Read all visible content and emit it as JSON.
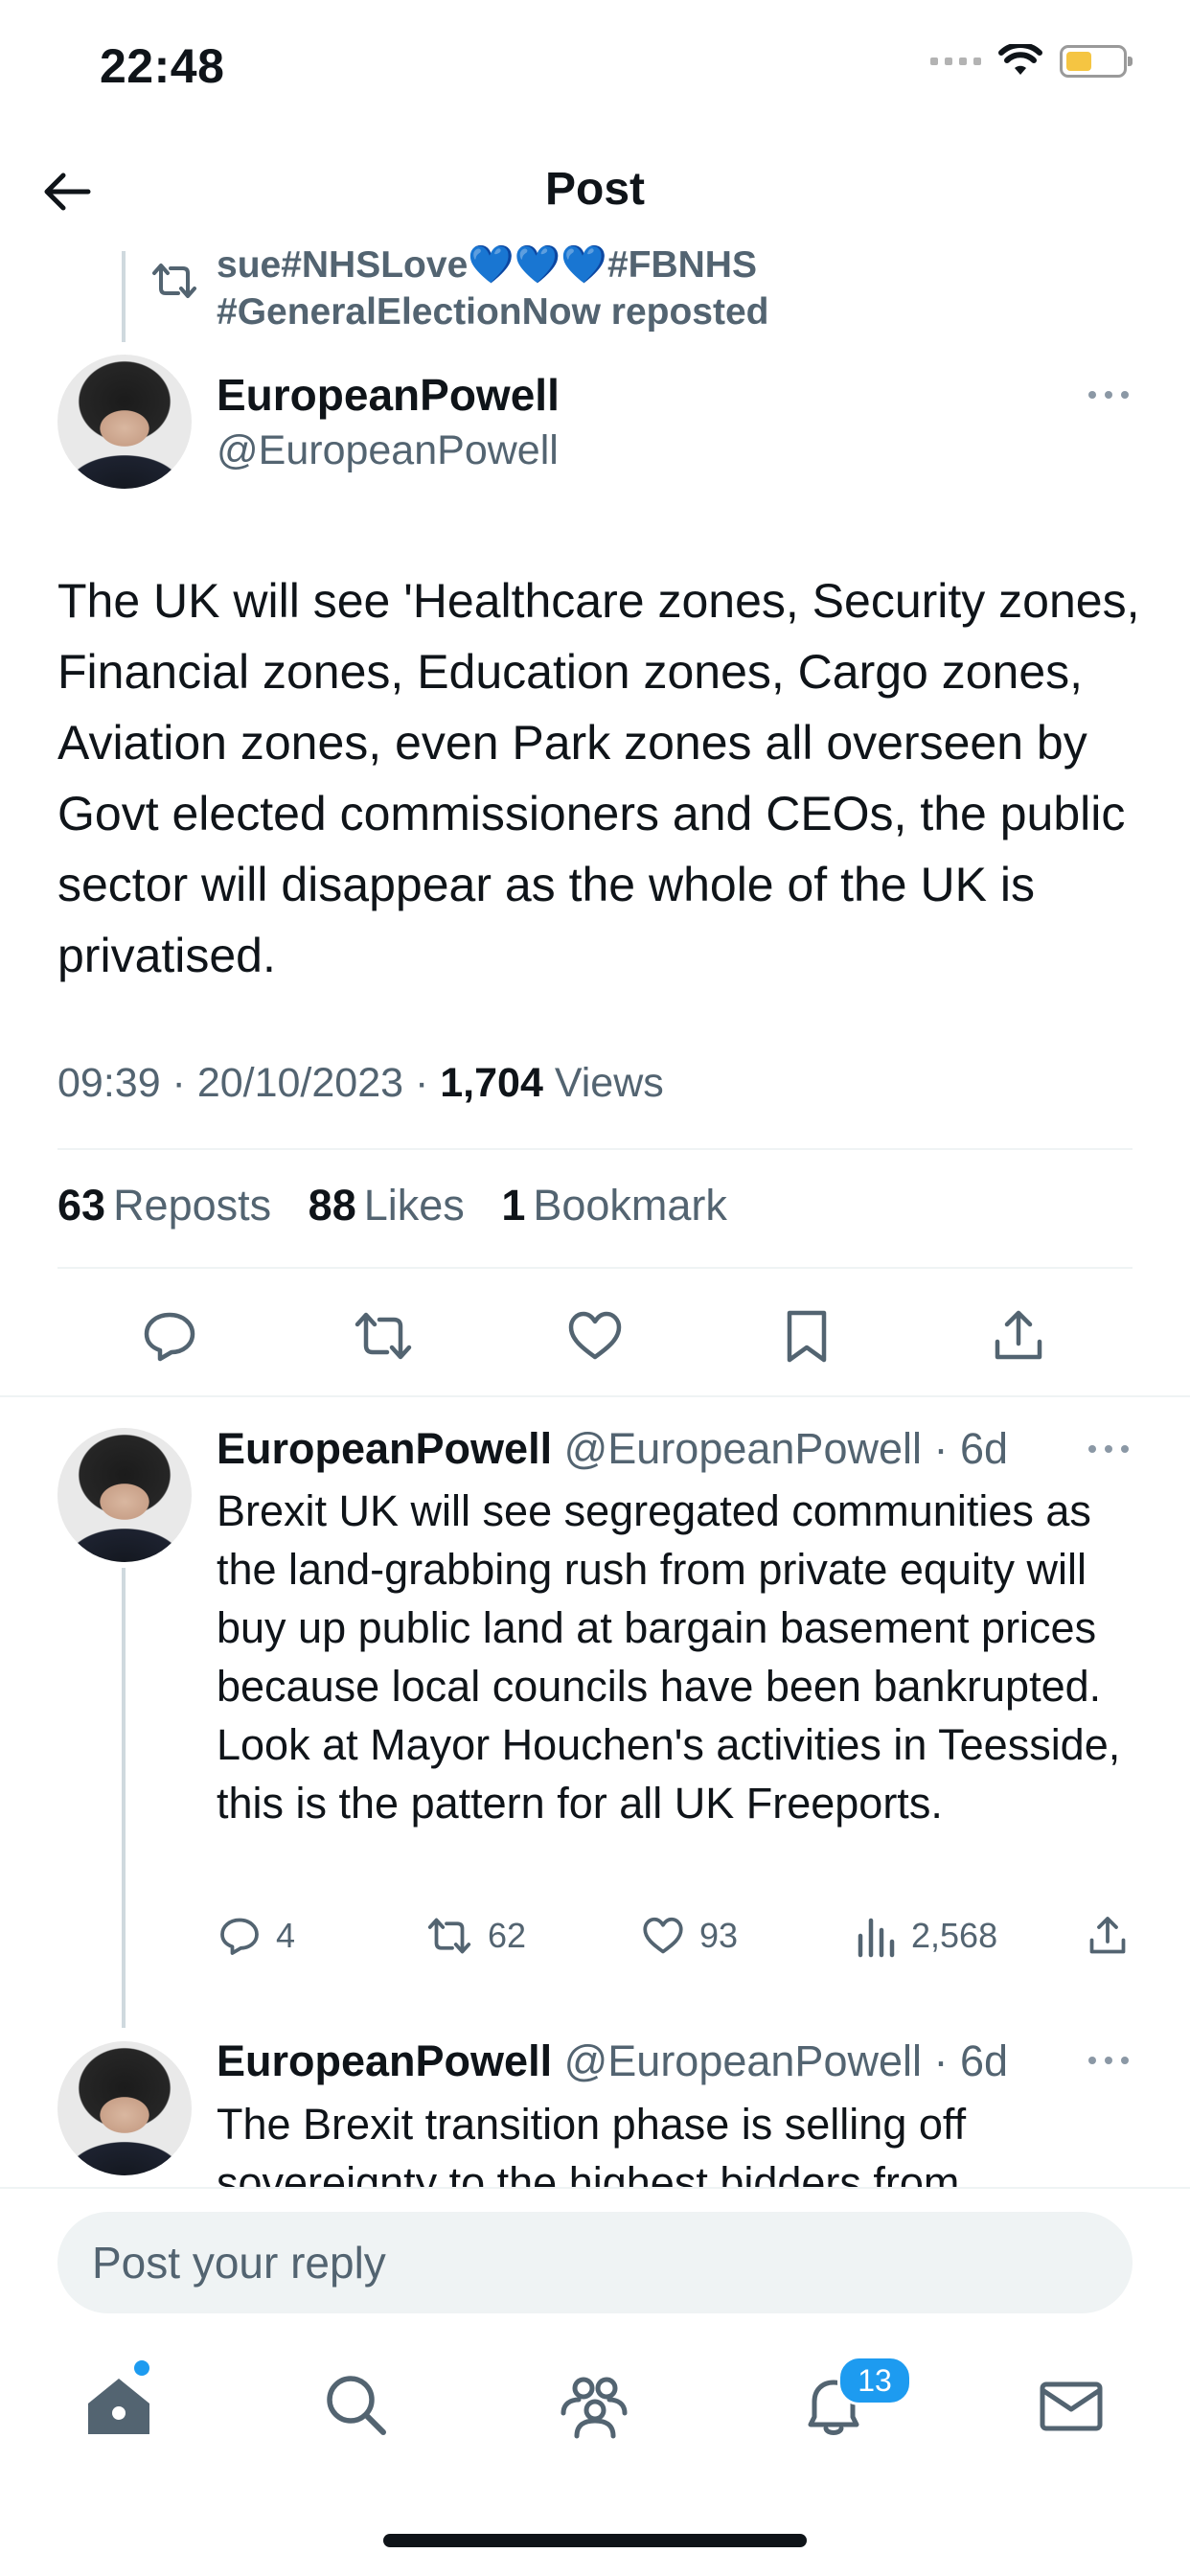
{
  "status_bar": {
    "time": "22:48"
  },
  "header": {
    "title": "Post"
  },
  "repost_context": {
    "line1": "sue#NHSLove💙💙💙#FBNHS",
    "line2": "#GeneralElectionNow reposted"
  },
  "main_post": {
    "name": "EuropeanPowell",
    "handle": "@EuropeanPowell",
    "text": "The UK will see 'Healthcare zones, Security zones, Financial zones, Education zones, Cargo zones, Aviation zones, even Park zones all overseen by Govt elected commissioners and CEOs, the public sector will disappear as the whole of the UK is privatised.",
    "time": "09:39",
    "date": "20/10/2023",
    "views_count": "1,704",
    "views_label": "Views",
    "reposts_count": "63",
    "reposts_label": "Reposts",
    "likes_count": "88",
    "likes_label": "Likes",
    "bookmarks_count": "1",
    "bookmarks_label": "Bookmark"
  },
  "replies": [
    {
      "name": "EuropeanPowell",
      "handle": "@EuropeanPowell",
      "age": "6d",
      "text": "Brexit UK will see segregated communities as the land-grabbing rush from private equity will buy up public land at bargain basement prices because local councils have been bankrupted. Look at Mayor Houchen's activities in Teesside, this is the pattern for all UK Freeports.",
      "replies": "4",
      "reposts": "62",
      "likes": "93",
      "views": "2,568"
    },
    {
      "name": "EuropeanPowell",
      "handle": "@EuropeanPowell",
      "age": "6d",
      "text": "The Brexit transition phase is selling off sovereignty to the highest bidders from"
    }
  ],
  "reply_bar": {
    "placeholder": "Post your reply"
  },
  "tab_bar": {
    "items": [
      "home-icon",
      "search-icon",
      "communities-icon",
      "notifications-icon",
      "messages-icon"
    ],
    "notifications_badge": "13"
  },
  "colors": {
    "accent": "#1d9bf0",
    "text_primary": "#0f1419",
    "text_secondary": "#536471",
    "battery": "#f5c542"
  }
}
